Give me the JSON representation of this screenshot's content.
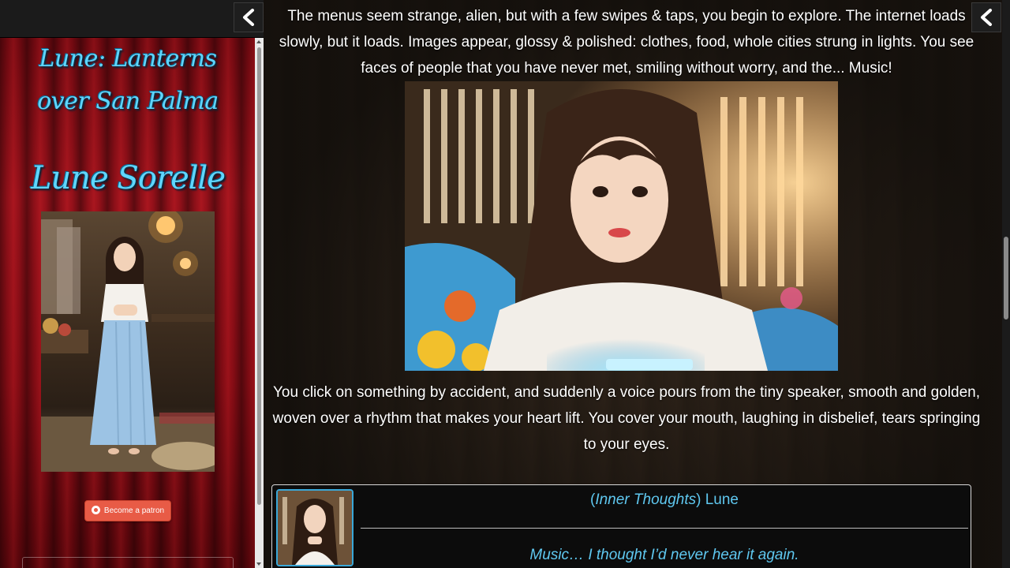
{
  "sidebar": {
    "story_title": "Lune: Lanterns over San Palma",
    "character_name": "Lune Sorelle",
    "patron_button": "Become a patron"
  },
  "main": {
    "paragraph_1": "The menus seem strange, alien, but with a few swipes & taps, you begin to explore. The internet loads slowly, but it loads. Images appear, glossy & polished: clothes, food, whole cities strung in lights. You see faces of people that you have never met, smiling without worry, and the... Music!",
    "paragraph_2": "You click on something by accident, and suddenly a voice pours from the tiny speaker, smooth and golden, woven over a rhythm that makes your heart lift. You cover your mouth, laughing in disbelief, tears springing to your eyes.",
    "thoughts": {
      "open_paren": "(",
      "label": "Inner Thoughts",
      "close_paren": ")",
      "speaker": " Lune",
      "text": "Music… I thought I’d never hear it again."
    }
  },
  "colors": {
    "accent_cyan": "#5fd6ff",
    "sidebar_red": "#a0121c",
    "patron_orange": "#e85b46"
  },
  "icons": {
    "collapse": "chevron-left-icon",
    "patreon": "patreon-icon"
  }
}
